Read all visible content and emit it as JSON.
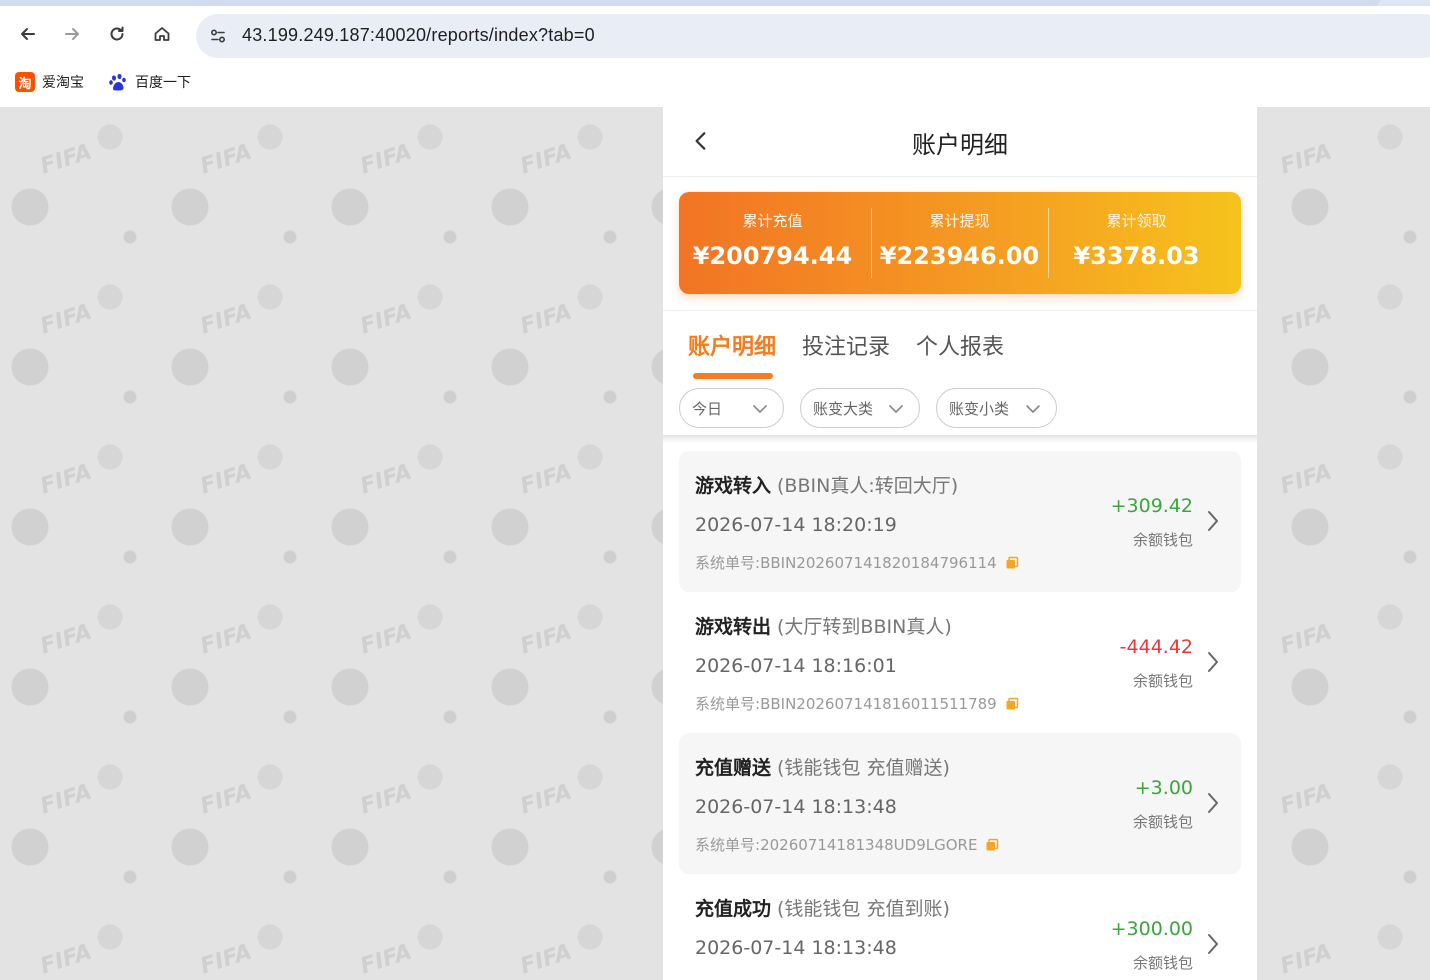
{
  "browser": {
    "url": "43.199.249.187:40020/reports/index?tab=0",
    "bookmarks": [
      {
        "label": "爱淘宝",
        "icon": "taobao-icon",
        "icon_text": "淘"
      },
      {
        "label": "百度一下",
        "icon": "baidu-paw-icon"
      }
    ]
  },
  "background": {
    "watermark": "FIFA"
  },
  "header": {
    "title": "账户明细"
  },
  "summary": {
    "items": [
      {
        "label": "累计充值",
        "value": "¥200794.44"
      },
      {
        "label": "累计提现",
        "value": "¥223946.00"
      },
      {
        "label": "累计领取",
        "value": "¥3378.03"
      }
    ]
  },
  "tabs": [
    {
      "label": "账户明细",
      "active": true
    },
    {
      "label": "投注记录",
      "active": false
    },
    {
      "label": "个人报表",
      "active": false
    }
  ],
  "filters": [
    {
      "label": "今日"
    },
    {
      "label": "账变大类"
    },
    {
      "label": "账变小类"
    }
  ],
  "records": [
    {
      "title": "游戏转入",
      "subtitle": "(BBIN真人:转回大厅)",
      "time": "2026-07-14 18:20:19",
      "order_label": "系统单号:",
      "order_no": "BBIN202607141820184796114",
      "amount": "+309.42",
      "sign": "pos",
      "wallet": "余额钱包"
    },
    {
      "title": "游戏转出",
      "subtitle": "(大厅转到BBIN真人)",
      "time": "2026-07-14 18:16:01",
      "order_label": "系统单号:",
      "order_no": "BBIN202607141816011511789",
      "amount": "-444.42",
      "sign": "neg",
      "wallet": "余额钱包"
    },
    {
      "title": "充值赠送",
      "subtitle": "(钱能钱包 充值赠送)",
      "time": "2026-07-14 18:13:48",
      "order_label": "系统单号:",
      "order_no": "20260714181348UD9LGORE",
      "amount": "+3.00",
      "sign": "pos",
      "wallet": "余额钱包"
    },
    {
      "title": "充值成功",
      "subtitle": "(钱能钱包 充值到账)",
      "time": "2026-07-14 18:13:48",
      "order_label": "",
      "order_no": "",
      "amount": "+300.00",
      "sign": "pos",
      "wallet": "余额钱包"
    }
  ],
  "colors": {
    "accent": "#f57c1f",
    "positive": "#3ba63b",
    "negative": "#e53935",
    "gradient_start": "#f27424",
    "gradient_end": "#f6c31c"
  }
}
